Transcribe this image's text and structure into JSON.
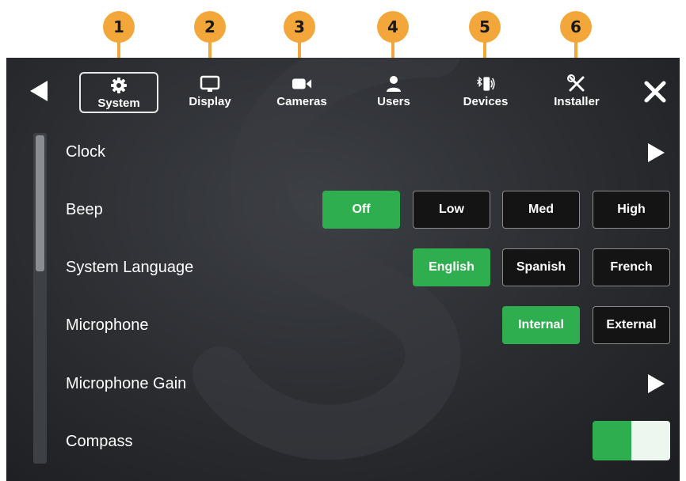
{
  "callouts": [
    "1",
    "2",
    "3",
    "4",
    "5",
    "6"
  ],
  "tabs": [
    {
      "label": "System",
      "icon": "gear-icon",
      "active": true
    },
    {
      "label": "Display",
      "icon": "monitor-icon",
      "active": false
    },
    {
      "label": "Cameras",
      "icon": "video-camera-icon",
      "active": false
    },
    {
      "label": "Users",
      "icon": "user-icon",
      "active": false
    },
    {
      "label": "Devices",
      "icon": "bluetooth-phone-icon",
      "active": false
    },
    {
      "label": "Installer",
      "icon": "tools-icon",
      "active": false
    }
  ],
  "rows": {
    "clock": {
      "label": "Clock"
    },
    "beep": {
      "label": "Beep",
      "options": [
        "Off",
        "Low",
        "Med",
        "High"
      ],
      "selected": "Off"
    },
    "language": {
      "label": "System Language",
      "options": [
        "English",
        "Spanish",
        "French"
      ],
      "selected": "English"
    },
    "microphone": {
      "label": "Microphone",
      "options": [
        "Internal",
        "External"
      ],
      "selected": "Internal"
    },
    "mic_gain": {
      "label": "Microphone Gain"
    },
    "compass": {
      "label": "Compass",
      "state": "on"
    }
  },
  "colors": {
    "accent_green": "#2fae4f",
    "callout_orange": "#f3a73a",
    "panel_dark": "#2a2c30"
  }
}
